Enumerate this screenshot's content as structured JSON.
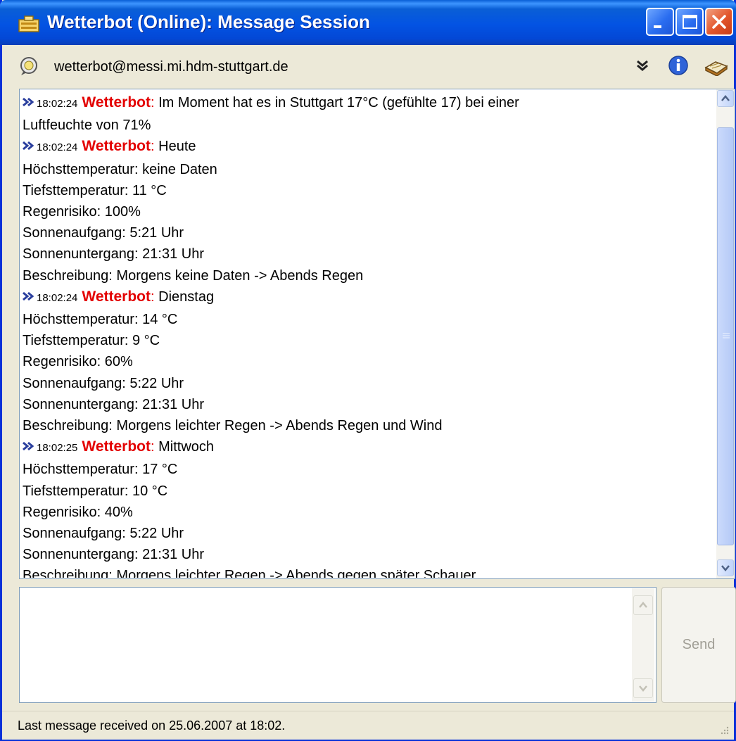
{
  "window": {
    "title": "Wetterbot (Online): Message Session"
  },
  "contact": {
    "address": "wetterbot@messi.mi.hdm-stuttgart.de"
  },
  "icons": {
    "title": "chat-window-icon",
    "status": "chat-bubble-icon",
    "menu": "chevron-down-icon",
    "info": "info-icon",
    "history": "book-icon"
  },
  "colors": {
    "title_bar": "#0353e3",
    "sender": "#e30000",
    "close_button": "#e2552b"
  },
  "messages": [
    {
      "time": "18:02:24",
      "sender": "Wetterbot",
      "lines": [
        "Im Moment hat es in Stuttgart 17°C (gefühlte 17) bei einer",
        "Luftfeuchte von 71%"
      ]
    },
    {
      "time": "18:02:24",
      "sender": "Wetterbot",
      "lines": [
        "Heute",
        "Höchsttemperatur: keine Daten",
        "Tiefsttemperatur: 11 °C",
        "Regenrisiko: 100%",
        "Sonnenaufgang: 5:21 Uhr",
        "Sonnenuntergang: 21:31 Uhr",
        "Beschreibung: Morgens keine Daten -> Abends Regen"
      ]
    },
    {
      "time": "18:02:24",
      "sender": "Wetterbot",
      "lines": [
        "Dienstag",
        "Höchsttemperatur: 14 °C",
        "Tiefsttemperatur: 9 °C",
        "Regenrisiko: 60%",
        "Sonnenaufgang: 5:22 Uhr",
        "Sonnenuntergang: 21:31 Uhr",
        "Beschreibung: Morgens leichter Regen -> Abends Regen und Wind"
      ]
    },
    {
      "time": "18:02:25",
      "sender": "Wetterbot",
      "lines": [
        "Mittwoch",
        "Höchsttemperatur: 17 °C",
        "Tiefsttemperatur: 10 °C",
        "Regenrisiko: 40%",
        "Sonnenaufgang: 5:22 Uhr",
        "Sonnenuntergang: 21:31 Uhr",
        "Beschreibung: Morgens leichter Regen -> Abends gegen später Schauer"
      ]
    }
  ],
  "input": {
    "value": "",
    "send_label": "Send"
  },
  "status": {
    "text": "Last message received on 25.06.2007 at 18:02."
  }
}
